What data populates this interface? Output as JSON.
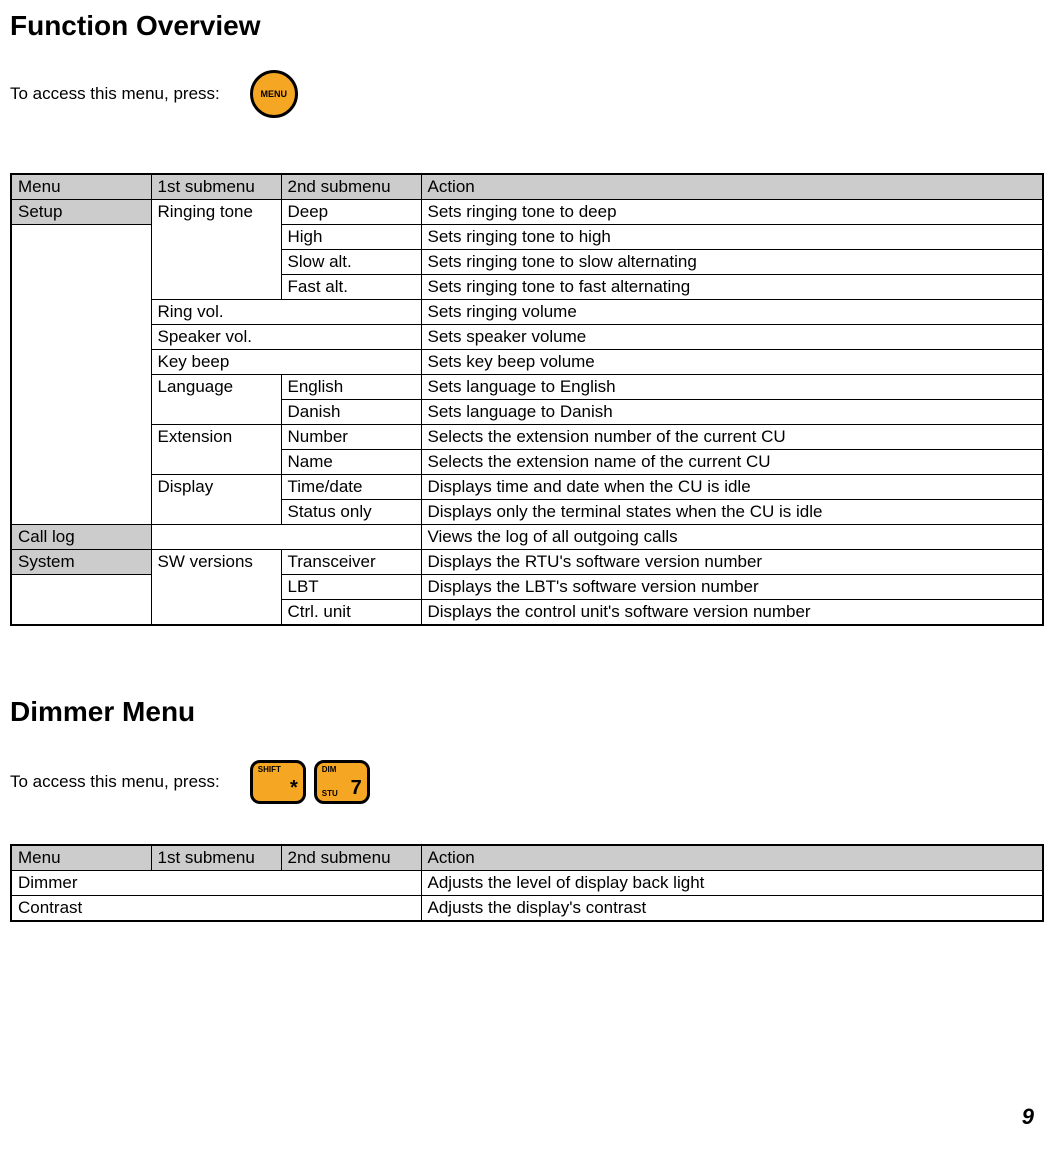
{
  "section1": {
    "title": "Function Overview",
    "access_text": "To access this menu, press:",
    "menu_button_label": "MENU",
    "headers": {
      "menu": "Menu",
      "sub1": "1st submenu",
      "sub2": "2nd submenu",
      "action": "Action"
    },
    "rows": {
      "setup": "Setup",
      "ringing": "Ringing tone",
      "deep": "Deep",
      "deep_a": "Sets ringing tone to deep",
      "high": "High",
      "high_a": "Sets ringing tone to high",
      "slow": "Slow alt.",
      "slow_a": "Sets ringing tone to slow alternating",
      "fast": "Fast alt.",
      "fast_a": "Sets ringing tone to fast alternating",
      "ringvol": "Ring vol.",
      "ringvol_a": "Sets ringing volume",
      "spkvol": "Speaker vol.",
      "spkvol_a": "Sets speaker volume",
      "keybeep": "Key beep",
      "keybeep_a": "Sets key beep volume",
      "lang": "Language",
      "eng": "English",
      "eng_a": "Sets language to English",
      "dan": "Danish",
      "dan_a": "Sets language to Danish",
      "ext": "Extension",
      "num": "Number",
      "num_a": "Selects the extension number of the current CU",
      "name": "Name",
      "name_a": "Selects the extension name of the current CU",
      "disp": "Display",
      "td": "Time/date",
      "td_a": "Displays time and date when the CU is idle",
      "so": "Status only",
      "so_a": "Displays only the terminal states when the CU is idle",
      "calllog": "Call log",
      "calllog_a": "Views the log of all outgoing calls",
      "system": "System",
      "swv": "SW versions",
      "trx": "Transceiver",
      "trx_a": "Displays the RTU's software version number",
      "lbt": "LBT",
      "lbt_a": "Displays the LBT's software version number",
      "ctrl": "Ctrl. unit",
      "ctrl_a": "Displays the control unit's software version number"
    }
  },
  "section2": {
    "title": "Dimmer Menu",
    "access_text": "To access this menu, press:",
    "shift_key": {
      "top": "SHIFT",
      "big": "*"
    },
    "dim_key": {
      "top": "DIM",
      "small": "STU",
      "big": "7"
    },
    "headers": {
      "menu": "Menu",
      "sub1": "1st submenu",
      "sub2": "2nd submenu",
      "action": "Action"
    },
    "rows": {
      "dimmer": "Dimmer",
      "dimmer_a": "Adjusts the level of display back light",
      "contrast": "Contrast",
      "contrast_a": "Adjusts the display's contrast"
    }
  },
  "page_number": "9"
}
